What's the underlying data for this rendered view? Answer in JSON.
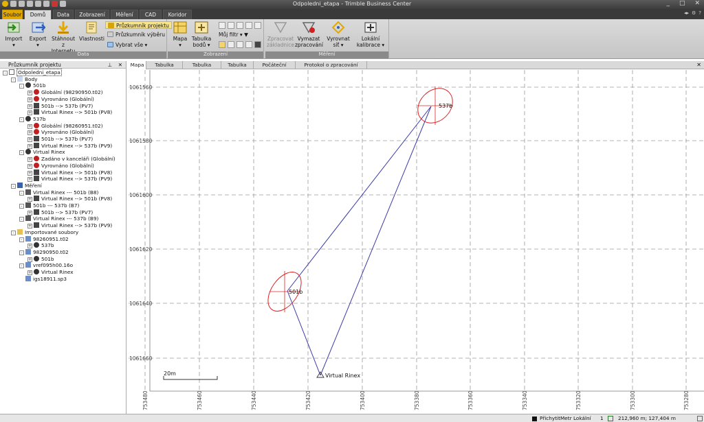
{
  "window": {
    "title": "Odpoledni_etapa - Trimble Business Center",
    "buttons": [
      "_",
      "□",
      "✕"
    ]
  },
  "menu_tabs": [
    "Soubor",
    "Domů",
    "Data",
    "Zobrazení",
    "Měření",
    "CAD",
    "Koridor"
  ],
  "ribbon": {
    "data_group": {
      "label": "Data",
      "import": "Import",
      "export": "Export",
      "download_line1": "Stáhnout z",
      "download_line2": "Internetu",
      "properties": "Vlastnosti",
      "project_explorer": "Průzkumník projektu",
      "selection_explorer": "Průzkumník výběru",
      "select_all": "Vybrat vše"
    },
    "view_group": {
      "label": "Zobrazení",
      "map": "Mapa",
      "table_line1": "Tabulka",
      "table_line2": "bodů",
      "filter": "Můj filtr"
    },
    "measure_group": {
      "label": "Měření",
      "process_line1": "Zpracovat",
      "process_line2": "základnice",
      "delete_line1": "Vymazat",
      "delete_line2": "zpracování",
      "adjust_line1": "Vyrovnat",
      "adjust_line2": "síť",
      "calib_line1": "Lokální",
      "calib_line2": "kalibrace"
    }
  },
  "explorer": {
    "title": "Průzkumník projektu",
    "items": [
      {
        "label": "Odpoledni_etapa",
        "level": 0,
        "exp": "-",
        "icon": "project",
        "sel": true
      },
      {
        "label": "Body",
        "level": 1,
        "exp": "-",
        "icon": "points"
      },
      {
        "label": "501b",
        "level": 2,
        "exp": "-",
        "icon": "point"
      },
      {
        "label": "Globální (98290950.t02)",
        "level": 3,
        "exp": "+",
        "icon": "global"
      },
      {
        "label": "Vyrovnáno (Globální)",
        "level": 3,
        "exp": "+",
        "icon": "adjusted"
      },
      {
        "label": "501b --> 537b (PV7)",
        "level": 3,
        "exp": "+",
        "icon": "vector"
      },
      {
        "label": "Virtual Rinex --> 501b (PV8)",
        "level": 3,
        "exp": "+",
        "icon": "vector"
      },
      {
        "label": "537b",
        "level": 2,
        "exp": "-",
        "icon": "point"
      },
      {
        "label": "Globální (98260951.t02)",
        "level": 3,
        "exp": "+",
        "icon": "global"
      },
      {
        "label": "Vyrovnáno (Globální)",
        "level": 3,
        "exp": "+",
        "icon": "adjusted"
      },
      {
        "label": "501b --> 537b (PV7)",
        "level": 3,
        "exp": "+",
        "icon": "vector"
      },
      {
        "label": "Virtual Rinex --> 537b (PV9)",
        "level": 3,
        "exp": "+",
        "icon": "vector"
      },
      {
        "label": "Virtual Rinex",
        "level": 2,
        "exp": "-",
        "icon": "point"
      },
      {
        "label": "Zadáno v kanceláři (Globální)",
        "level": 3,
        "exp": "+",
        "icon": "global"
      },
      {
        "label": "Vyrovnáno (Globální)",
        "level": 3,
        "exp": "+",
        "icon": "adjusted"
      },
      {
        "label": "Virtual Rinex --> 501b (PV8)",
        "level": 3,
        "exp": "+",
        "icon": "vector"
      },
      {
        "label": "Virtual Rinex --> 537b (PV9)",
        "level": 3,
        "exp": "+",
        "icon": "vector"
      },
      {
        "label": "Měření",
        "level": 1,
        "exp": "-",
        "icon": "measure"
      },
      {
        "label": "Virtual Rinex --- 501b (B8)",
        "level": 2,
        "exp": "-",
        "icon": "baseline"
      },
      {
        "label": "Virtual Rinex --> 501b (PV8)",
        "level": 3,
        "exp": "+",
        "icon": "vector"
      },
      {
        "label": "501b --- 537b (B7)",
        "level": 2,
        "exp": "-",
        "icon": "baseline"
      },
      {
        "label": "501b --> 537b (PV7)",
        "level": 3,
        "exp": "+",
        "icon": "vector"
      },
      {
        "label": "Virtual Rinex --- 537b (B9)",
        "level": 2,
        "exp": "-",
        "icon": "baseline"
      },
      {
        "label": "Virtual Rinex --> 537b (PV9)",
        "level": 3,
        "exp": "+",
        "icon": "vector"
      },
      {
        "label": "Importované soubory",
        "level": 1,
        "exp": "-",
        "icon": "folder"
      },
      {
        "label": "98260951.t02",
        "level": 2,
        "exp": "-",
        "icon": "file"
      },
      {
        "label": "537b",
        "level": 3,
        "exp": "+",
        "icon": "point"
      },
      {
        "label": "98290950.t02",
        "level": 2,
        "exp": "-",
        "icon": "file"
      },
      {
        "label": "501b",
        "level": 3,
        "exp": "+",
        "icon": "point"
      },
      {
        "label": "vref095h00.16o",
        "level": 2,
        "exp": "-",
        "icon": "file"
      },
      {
        "label": "Virtual Rinex",
        "level": 3,
        "exp": "+",
        "icon": "point"
      },
      {
        "label": "igs18911.sp3",
        "level": 2,
        "exp": "",
        "icon": "file"
      }
    ]
  },
  "view_tabs": [
    "Mapa",
    "Tabulka měření",
    "Tabulka vektorů",
    "Tabulka bodů",
    "Počáteční stránka",
    "Protokol o zpracování základnic"
  ],
  "map": {
    "northing_labels": [
      "1061560",
      "1061580",
      "1061600",
      "1061620",
      "1061640",
      "1061660"
    ],
    "easting_labels": [
      "753480",
      "753460",
      "753440",
      "753420",
      "753400",
      "753380",
      "753360",
      "753340",
      "753320",
      "753300",
      "753280"
    ],
    "points": [
      {
        "name": "537b"
      },
      {
        "name": "501b"
      },
      {
        "name": "Virtual Rinex"
      }
    ],
    "scale_label": "20m",
    "colors": {
      "vector": "#3a3aa8",
      "ellipse": "#e02020",
      "grid": "#9a9a9a"
    }
  },
  "status": {
    "snap": "Přichytit",
    "unit": "Metr",
    "mode": "Lokální",
    "count": "1",
    "coords": "212,960 m; 127,404 m"
  }
}
